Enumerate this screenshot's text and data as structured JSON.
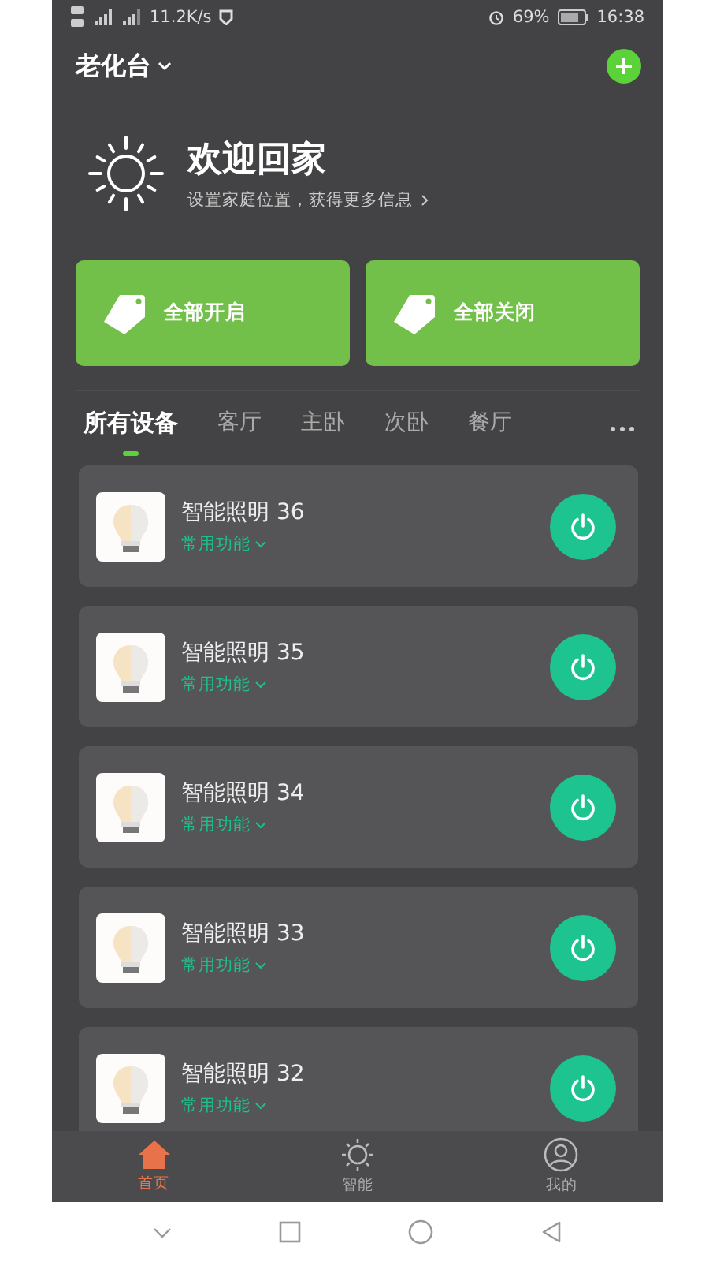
{
  "status_bar": {
    "network_speed": "11.2K/s",
    "battery": "69%",
    "time": "16:38"
  },
  "header": {
    "home_name": "老化台"
  },
  "welcome": {
    "title": "欢迎回家",
    "subtitle": "设置家庭位置，获得更多信息"
  },
  "actions": [
    {
      "label": "全部开启"
    },
    {
      "label": "全部关闭"
    }
  ],
  "tabs": [
    {
      "label": "所有设备",
      "selected": true
    },
    {
      "label": "客厅",
      "selected": false
    },
    {
      "label": "主卧",
      "selected": false
    },
    {
      "label": "次卧",
      "selected": false
    },
    {
      "label": "餐厅",
      "selected": false
    }
  ],
  "devices": [
    {
      "name": "智能照明 36",
      "menu": "常用功能"
    },
    {
      "name": "智能照明 35",
      "menu": "常用功能"
    },
    {
      "name": "智能照明 34",
      "menu": "常用功能"
    },
    {
      "name": "智能照明 33",
      "menu": "常用功能"
    },
    {
      "name": "智能照明 32",
      "menu": "常用功能"
    }
  ],
  "bottom_nav": [
    {
      "label": "首页",
      "kind": "home",
      "selected": true
    },
    {
      "label": "智能",
      "kind": "smart",
      "selected": false
    },
    {
      "label": "我的",
      "kind": "profile",
      "selected": false
    }
  ]
}
